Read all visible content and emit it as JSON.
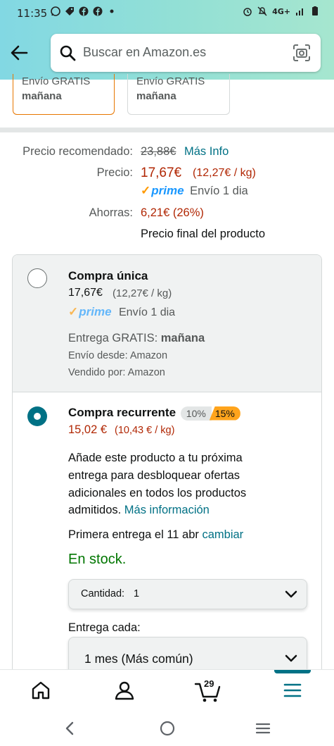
{
  "status_bar": {
    "time": "11:35",
    "network": "4G+"
  },
  "search": {
    "placeholder": "Buscar en Amazon.es"
  },
  "delivery_cards": [
    {
      "line1": "Envío GRATIS",
      "line2": "mañana"
    },
    {
      "line1": "Envío GRATIS",
      "line2": "mañana"
    }
  ],
  "pricing": {
    "recommended_label": "Precio recomendado:",
    "recommended_value": "23,88€",
    "more_info": "Más Info",
    "price_label": "Precio:",
    "price_value": "17,67€",
    "price_unit": "(12,27€ / kg)",
    "prime_text": "prime",
    "shipping": "Envío 1 dia",
    "savings_label": "Ahorras:",
    "savings_value": "6,21€ (26%)",
    "final_note": "Precio final del producto"
  },
  "option_one_time": {
    "title": "Compra única",
    "price": "17,67€",
    "unit": "(12,27€ / kg)",
    "prime_text": "prime",
    "shipping": "Envío 1 dia",
    "delivery_label": "Entrega GRATIS:",
    "delivery_value": "mañana",
    "ships_from": "Envío desde: Amazon",
    "sold_by": "Vendido por: Amazon"
  },
  "option_recurring": {
    "title": "Compra recurrente",
    "badge_1": "10%",
    "badge_2": "15%",
    "price": "15,02 €",
    "unit": "(10,43 € / kg)",
    "desc_line1": "Añade este producto a tu próxima",
    "desc_line2": "entrega para desbloquear ofertas",
    "desc_line3": "adicionales en todos los productos",
    "desc_line4": "admitidos.",
    "more_link": "Más información",
    "first_delivery": "Primera entrega el 11 abr",
    "change_link": "cambiar",
    "stock": "En stock.",
    "quantity_label": "Cantidad:",
    "quantity_value": "1",
    "frequency_label": "Entrega cada:",
    "frequency_value": "1 mes (Más común)"
  },
  "bottom_nav": {
    "cart_count": "29"
  },
  "colors": {
    "link": "#007185",
    "price_red": "#b12704",
    "prime_blue": "#1a98ff",
    "accent_orange": "#ff9900",
    "stock_green": "#007600"
  }
}
